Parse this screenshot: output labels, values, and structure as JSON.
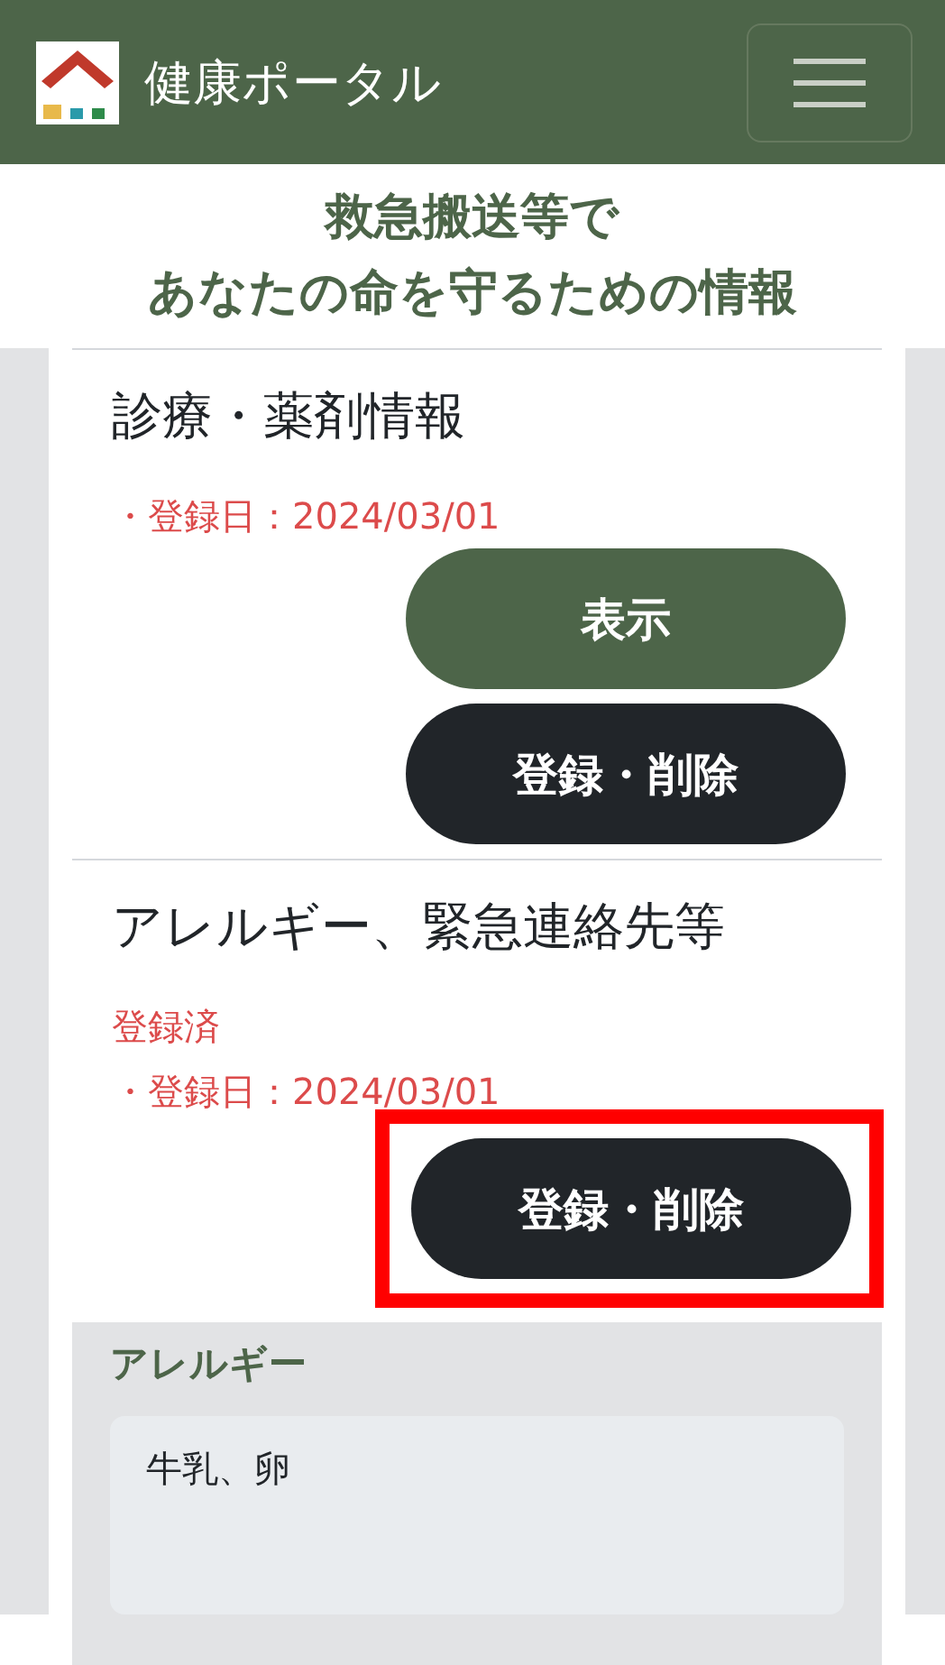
{
  "header": {
    "title": "健康ポータル"
  },
  "heading": [
    "救急搬送等で",
    "あなたの命を守るための情報"
  ],
  "sections": [
    {
      "title": "診療・薬剤情報",
      "notes": [
        {
          "text": "・登録日：2024/03/01"
        }
      ],
      "buttons": [
        {
          "label": "表示",
          "kind": "primary",
          "highlighted": false
        },
        {
          "label": "登録・削除",
          "kind": "dark",
          "highlighted": false
        }
      ]
    },
    {
      "title": "アレルギー、緊急連絡先等",
      "notes": [
        {
          "text": "登録済"
        },
        {
          "text": "・登録日：2024/03/01"
        }
      ],
      "buttons": [
        {
          "label": "登録・削除",
          "kind": "dark",
          "highlighted": true
        }
      ],
      "details": [
        {
          "label": "アレルギー",
          "value": "牛乳、卵"
        }
      ]
    }
  ]
}
